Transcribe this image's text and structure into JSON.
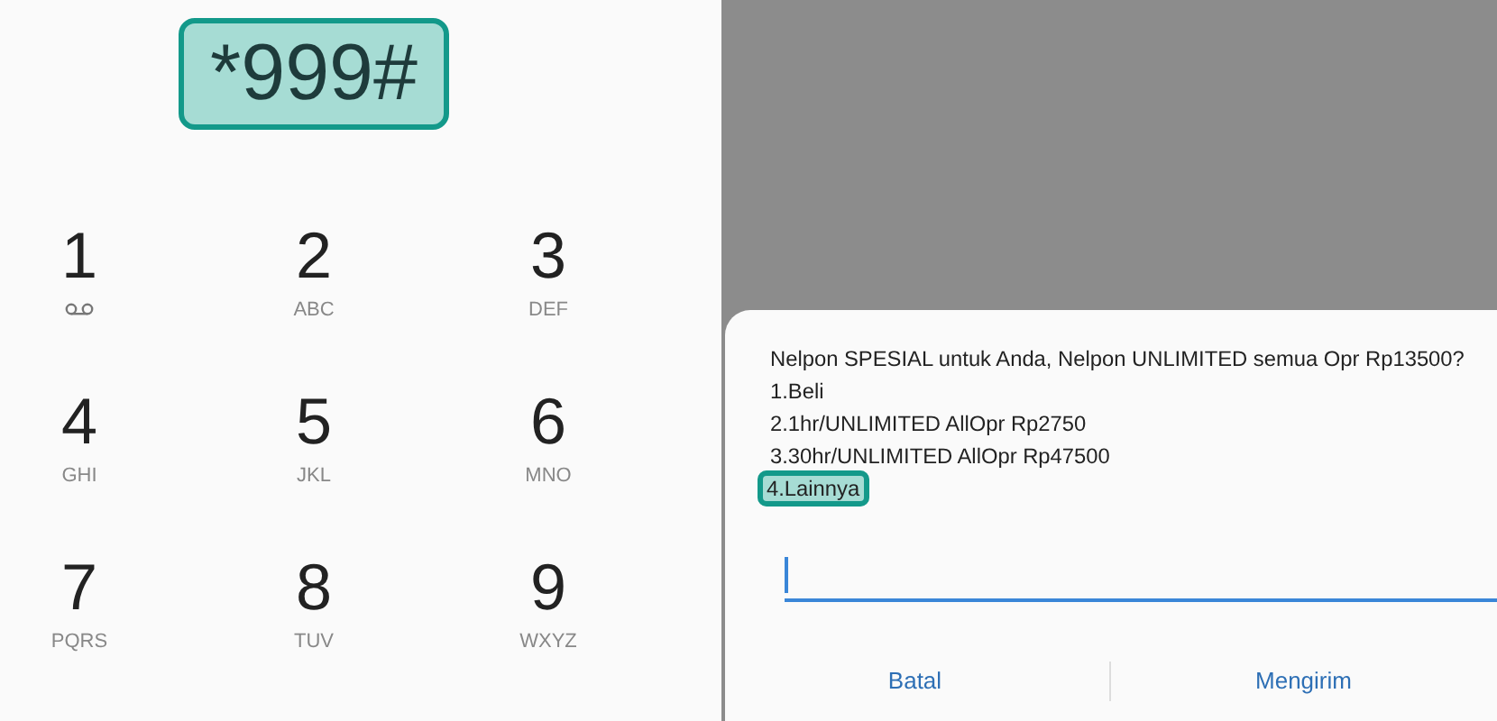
{
  "dialer": {
    "number": "*999#",
    "highlighted": true,
    "keys": [
      {
        "digit": "1",
        "kind": "voicemail"
      },
      {
        "digit": "2",
        "kind": "letters",
        "letters": "ABC"
      },
      {
        "digit": "3",
        "kind": "letters",
        "letters": "DEF"
      },
      {
        "digit": "4",
        "kind": "letters",
        "letters": "GHI"
      },
      {
        "digit": "5",
        "kind": "letters",
        "letters": "JKL"
      },
      {
        "digit": "6",
        "kind": "letters",
        "letters": "MNO"
      },
      {
        "digit": "7",
        "kind": "letters",
        "letters": "PQRS"
      },
      {
        "digit": "8",
        "kind": "letters",
        "letters": "TUV"
      },
      {
        "digit": "9",
        "kind": "letters",
        "letters": "WXYZ"
      }
    ]
  },
  "ussd_dialog": {
    "lines": [
      {
        "text": "Nelpon SPESIAL untuk Anda, Nelpon UNLIMITED semua Opr Rp13500?",
        "highlighted": false
      },
      {
        "text": "1.Beli",
        "highlighted": false
      },
      {
        "text": "2.1hr/UNLIMITED AllOpr Rp2750",
        "highlighted": false
      },
      {
        "text": "3.30hr/UNLIMITED AllOpr Rp47500",
        "highlighted": false
      },
      {
        "text": "4.Lainnya",
        "highlighted": true
      }
    ],
    "buttons": [
      "Batal",
      "Mengirim"
    ]
  }
}
